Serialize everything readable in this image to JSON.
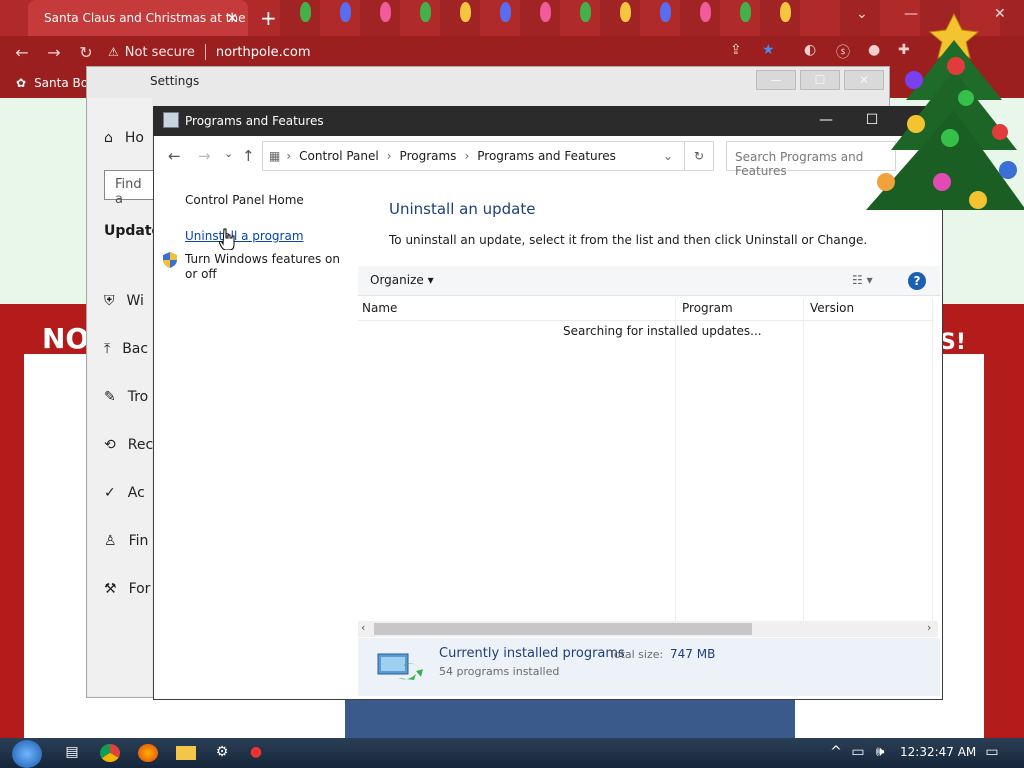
{
  "browser": {
    "tab_title": "Santa Claus and Christmas at the",
    "security_label": "Not secure",
    "url": "northpole.com",
    "bookmark": "Santa Bo"
  },
  "settings": {
    "title": "Settings",
    "home_label": "Ho",
    "find_placeholder": "Find a",
    "section_label": "Update",
    "items": [
      "Wi",
      "Bac",
      "Tro",
      "Rec",
      "Ac",
      "Fin",
      "For"
    ]
  },
  "programs_window": {
    "title": "Programs and Features",
    "breadcrumb": [
      "Control Panel",
      "Programs",
      "Programs and Features"
    ],
    "search_placeholder": "Search Programs and Features",
    "sidebar": {
      "home_link": "Control Panel Home",
      "uninstall_link": "Uninstall a program",
      "windows_features_link": "Turn Windows features on or off"
    },
    "heading": "Uninstall an update",
    "description": "To uninstall an update, select it from the list and then click Uninstall or Change.",
    "toolbar": {
      "organize_label": "Organize",
      "help_label": "?"
    },
    "columns": [
      "Name",
      "Program",
      "Version"
    ],
    "list_status": "Searching for installed updates...",
    "status_bar": {
      "title": "Currently installed programs",
      "total_size_label": "Total size:",
      "total_size_value": "747 MB",
      "count_text": "54 programs installed"
    }
  },
  "page_banner": {
    "left": "NO",
    "right": "S!"
  },
  "taskbar": {
    "clock": "12:32:47 AM"
  }
}
